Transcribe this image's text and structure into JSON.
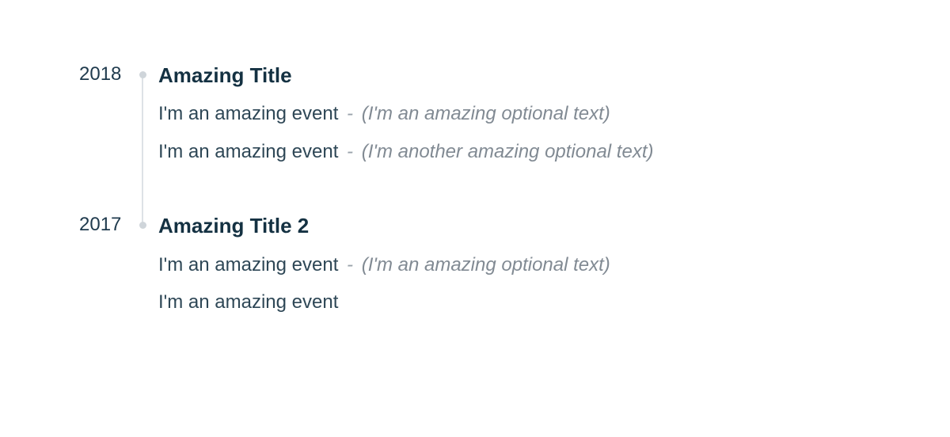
{
  "timeline": [
    {
      "year": "2018",
      "title": "Amazing Title",
      "events": [
        {
          "text": "I'm an amazing event",
          "sep": "-",
          "optional": "(I'm an amazing optional text)"
        },
        {
          "text": "I'm an amazing event",
          "sep": "-",
          "optional": "(I'm another amazing optional text)"
        }
      ]
    },
    {
      "year": "2017",
      "title": "Amazing Title 2",
      "events": [
        {
          "text": "I'm an amazing event",
          "sep": "-",
          "optional": "(I'm an amazing optional text)"
        },
        {
          "text": "I'm an amazing event",
          "sep": "",
          "optional": ""
        }
      ]
    }
  ]
}
